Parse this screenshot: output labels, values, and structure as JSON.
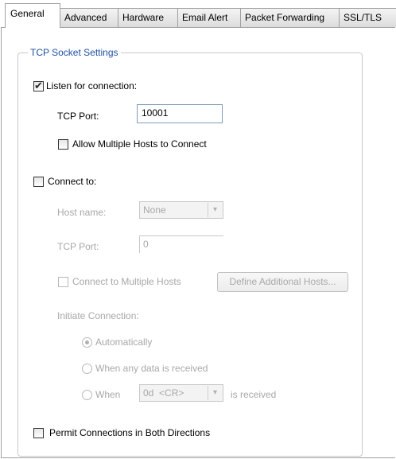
{
  "tabs": [
    {
      "label": "General",
      "active": true
    },
    {
      "label": "Advanced"
    },
    {
      "label": "Hardware"
    },
    {
      "label": "Email Alert"
    },
    {
      "label": "Packet Forwarding"
    },
    {
      "label": "SSL/TLS"
    }
  ],
  "group": {
    "legend": "TCP Socket Settings"
  },
  "listen": {
    "label": "Listen for connection:",
    "checked": true,
    "tcp_port_label": "TCP Port:",
    "tcp_port_value": "10001",
    "allow_multiple_label": "Allow Multiple Hosts to Connect",
    "allow_multiple_checked": false
  },
  "connect": {
    "label": "Connect to:",
    "checked": false,
    "host_name_label": "Host name:",
    "host_name_value": "None",
    "tcp_port_label": "TCP Port:",
    "tcp_port_value": "0",
    "multiple_hosts_label": "Connect to Multiple Hosts",
    "define_hosts_button": "Define Additional Hosts...",
    "initiate_label": "Initiate Connection:",
    "radio_auto": "Automatically",
    "radio_data": "When any data is received",
    "radio_when": "When",
    "when_value": "0d  <CR>",
    "is_received": "is received",
    "selected_radio": "auto"
  },
  "permit": {
    "label": "Permit Connections in Both Directions",
    "checked": false
  },
  "icons": {
    "check": "check-icon",
    "dropdown": "chevron-down-icon"
  }
}
